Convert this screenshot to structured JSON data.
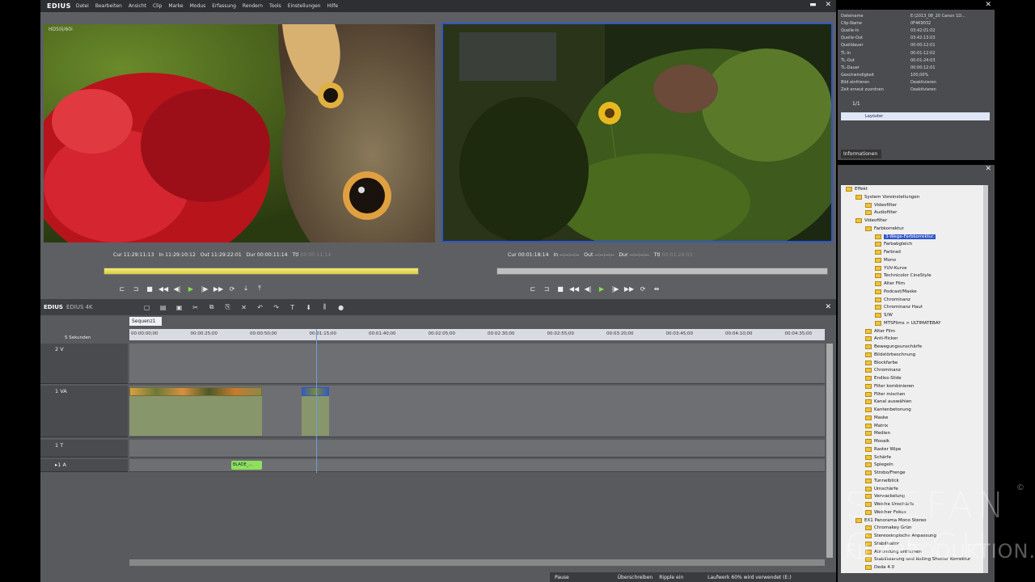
{
  "menubar": {
    "logo": "EDIUS",
    "items": [
      "Datei",
      "Bearbeiten",
      "Ansicht",
      "Clip",
      "Marke",
      "Modus",
      "Erfassung",
      "Rendern",
      "Tools",
      "Einstellungen",
      "Hilfe"
    ],
    "minimize": "▬",
    "close": "✕"
  },
  "player": {
    "overlay": "HD50i/60i",
    "cur": "Cur 11:29:11:13",
    "in": "In 11:29:10:12",
    "out": "Out 11:29:22:01",
    "dur": "Dur 00:00:11:14",
    "ttl_label": "Ttl",
    "ttl": "00:00:11:14"
  },
  "recorder": {
    "cur": "Cur 00:01:18:14",
    "in": "In --:--:--:--",
    "out": "Out --:--:--:--",
    "dur": "Dur --:--:--:--",
    "ttl_label": "Ttl",
    "ttl": "00:01:24:03"
  },
  "timeline": {
    "title": "EDIUS",
    "preset": "EDIUS 4K",
    "sequence_tab": "Sequenz1",
    "scale": "5 Sekunden",
    "ruler_ticks": [
      "00:00:00;00",
      "00:00:25;00",
      "00:00:50;00",
      "00:01:15;00",
      "00:01:40;00",
      "00:02:05;00",
      "00:02:30;00",
      "00:02:55;00",
      "00:03:20;00",
      "00:03:45;00",
      "00:04:10;00",
      "00:04:35;00"
    ],
    "tracks": [
      {
        "name": "2 V"
      },
      {
        "name": "1 VA"
      },
      {
        "name": "1 T"
      },
      {
        "name": "▸1 A"
      }
    ],
    "audio_clip_label": "BLADE_..."
  },
  "status": {
    "pause": "Pause",
    "overwrite": "Überschreiben",
    "ripple": "Ripple ein",
    "disk": "Laufwerk 60% wird verwendet (E:)"
  },
  "info_panel": {
    "rows": [
      {
        "k": "Dateiname",
        "v": "E:\\2013_08_20 Canon 1D..."
      },
      {
        "k": "Clip-Name",
        "v": "0F4K9032"
      },
      {
        "k": "Quelle-In",
        "v": "03:42:01:02"
      },
      {
        "k": "Quelle-Out",
        "v": "03:42:13:03"
      },
      {
        "k": "Quelldauer",
        "v": "00:00:12:01"
      },
      {
        "k": "TL-In",
        "v": "00:01:12:02"
      },
      {
        "k": "TL-Out",
        "v": "00:01:24:03"
      },
      {
        "k": "TL-Dauer",
        "v": "00:00:12:01"
      },
      {
        "k": "Geschwindigkeit",
        "v": "100,00%"
      },
      {
        "k": "Bild einfrieren",
        "v": "Deaktivieren"
      },
      {
        "k": "Zeit erneut zuordnen",
        "v": "Deaktivieren"
      }
    ],
    "layout_label": "Layouter",
    "page": "1/1",
    "tab": "Informationen"
  },
  "effects_tree": {
    "items": [
      {
        "label": "Effekt",
        "indent": 0
      },
      {
        "label": "System Voreinstellungen",
        "indent": 1
      },
      {
        "label": "Videofilter",
        "indent": 2
      },
      {
        "label": "Audiofilter",
        "indent": 2
      },
      {
        "label": "Videofilter",
        "indent": 1
      },
      {
        "label": "Farbkorrektur",
        "indent": 2
      },
      {
        "label": "3-Wege-Farbkorrektur",
        "indent": 3,
        "selected": true
      },
      {
        "label": "Farbabgleich",
        "indent": 3
      },
      {
        "label": "Farbrad",
        "indent": 3
      },
      {
        "label": "Mono",
        "indent": 3
      },
      {
        "label": "YUV-Kurve",
        "indent": 3
      },
      {
        "label": "Technicolor CineStyle",
        "indent": 3
      },
      {
        "label": "Alter Film",
        "indent": 3
      },
      {
        "label": "Podcast/Maske",
        "indent": 3
      },
      {
        "label": "Chrominanz",
        "indent": 3
      },
      {
        "label": "Chrominanz Haut",
        "indent": 3
      },
      {
        "label": "S/W",
        "indent": 3
      },
      {
        "label": "MTSFilms > ULTIMATEBAY",
        "indent": 3
      },
      {
        "label": "Alter Film",
        "indent": 2
      },
      {
        "label": "Anti-flicker",
        "indent": 2
      },
      {
        "label": "Bewegungsunschärfe",
        "indent": 2
      },
      {
        "label": "Bildstörbeschnung",
        "indent": 2
      },
      {
        "label": "Blockfarbe",
        "indent": 2
      },
      {
        "label": "Chrominanz",
        "indent": 2
      },
      {
        "label": "Endlos-Slide",
        "indent": 2
      },
      {
        "label": "Filter kombinieren",
        "indent": 2
      },
      {
        "label": "Filter mischen",
        "indent": 2
      },
      {
        "label": "Kanal auswählen",
        "indent": 2
      },
      {
        "label": "Kantenbetonung",
        "indent": 2
      },
      {
        "label": "Maske",
        "indent": 2
      },
      {
        "label": "Matrix",
        "indent": 2
      },
      {
        "label": "Medien",
        "indent": 2
      },
      {
        "label": "Mosaik",
        "indent": 2
      },
      {
        "label": "Raster Wipe",
        "indent": 2
      },
      {
        "label": "Schärfe",
        "indent": 2
      },
      {
        "label": "Spiegeln",
        "indent": 2
      },
      {
        "label": "Strobo/Frenge",
        "indent": 2
      },
      {
        "label": "Tunnelblick",
        "indent": 2
      },
      {
        "label": "Umschärfe",
        "indent": 2
      },
      {
        "label": "Verwackelung",
        "indent": 2
      },
      {
        "label": "Weiche Unschärfe",
        "indent": 2
      },
      {
        "label": "Weicher Fokus",
        "indent": 2
      },
      {
        "label": "EX1 Panorama Mono Stereo",
        "indent": 1
      },
      {
        "label": "Chromakey Grün",
        "indent": 2
      },
      {
        "label": "Stereoskopische Anpassung",
        "indent": 2
      },
      {
        "label": "Stabilisator",
        "indent": 2
      },
      {
        "label": "Abrundung entfernen",
        "indent": 2
      },
      {
        "label": "Stabilisierung und Rolling Shutter Korrektur",
        "indent": 2
      },
      {
        "label": "Deda 4.0",
        "indent": 2
      }
    ]
  },
  "watermark": {
    "line1": "STEFAN CZECH",
    "line2": "FILMPRODUKTION.COM",
    "copyright": "©"
  },
  "colors": {
    "accent_blue": "#2f57c9",
    "play_green": "#7fe34a",
    "folder_yellow": "#f0c33a"
  }
}
